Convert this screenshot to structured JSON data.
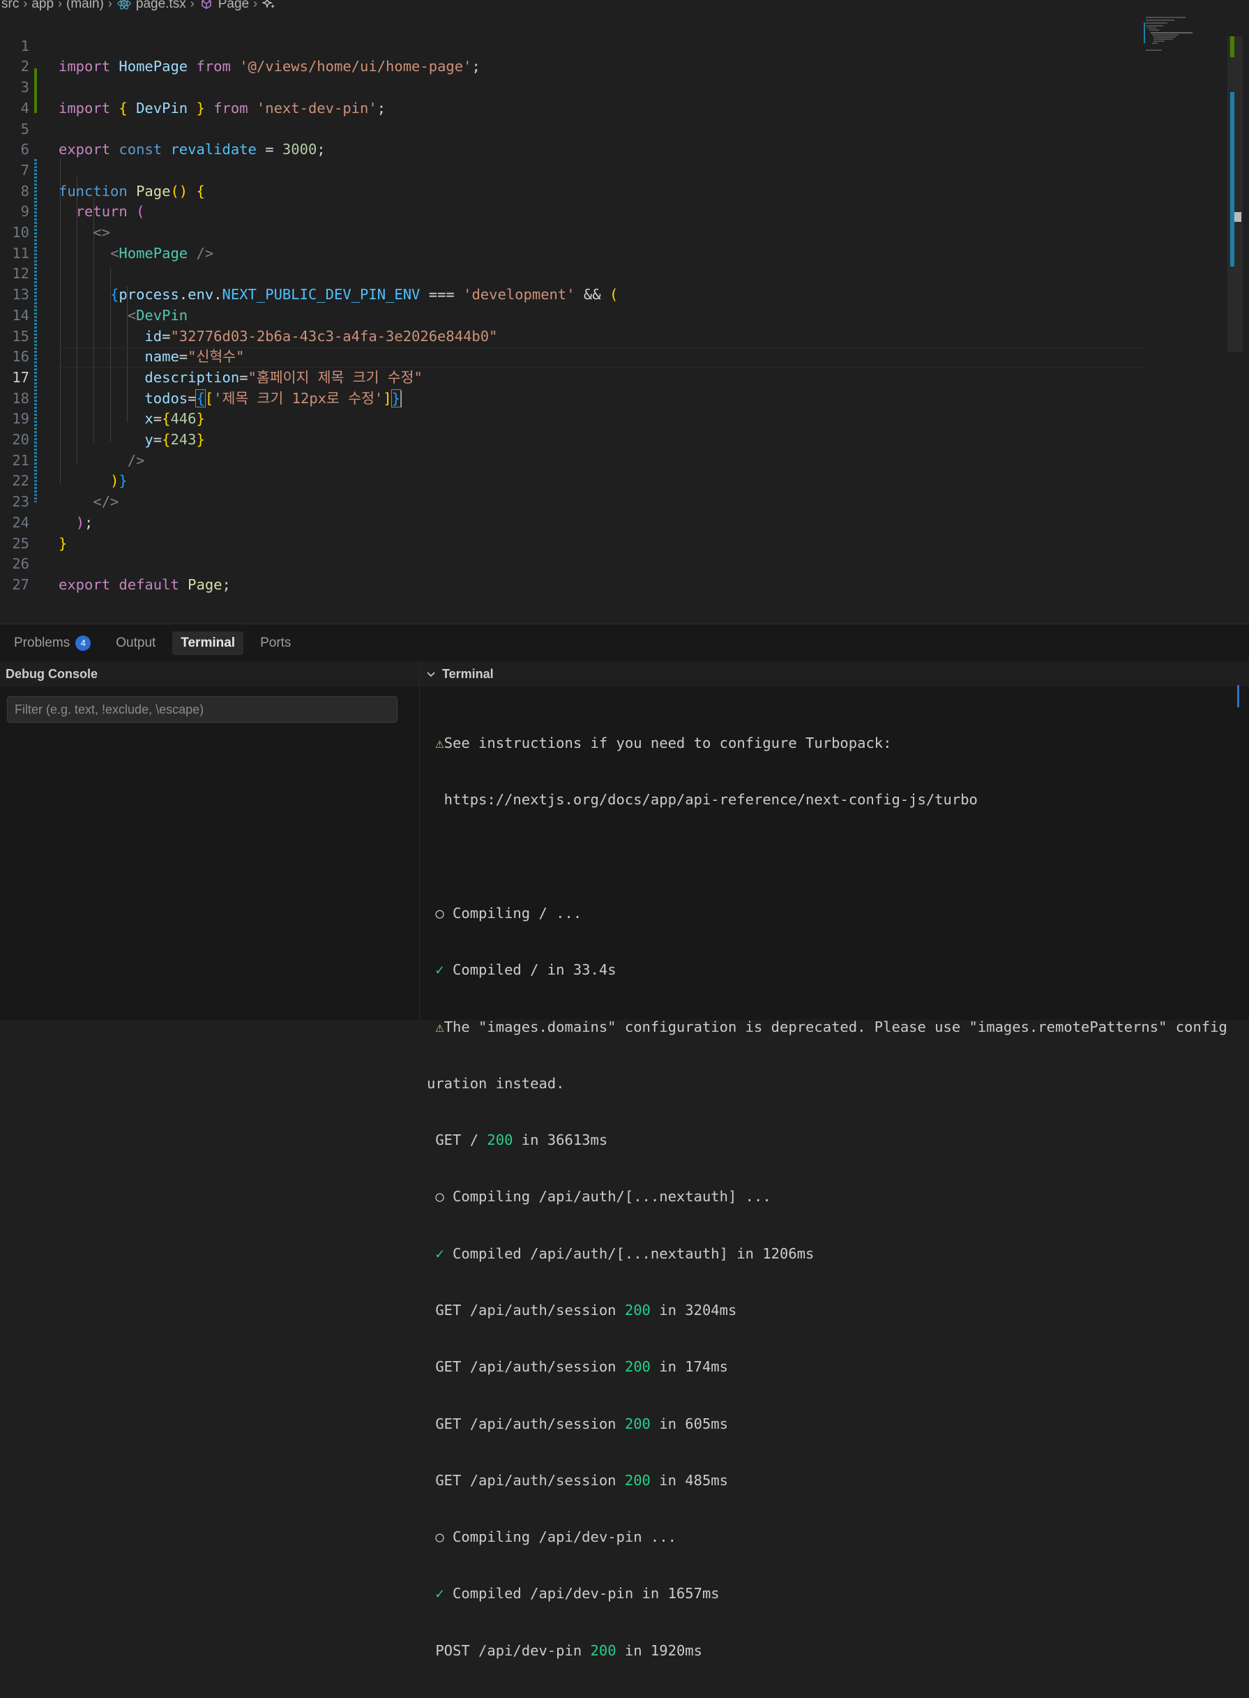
{
  "breadcrumb": {
    "items": [
      "src",
      "app",
      "(main)",
      "page.tsx",
      "Page"
    ],
    "icons": [
      "react-icon",
      "symbol-method-icon",
      "sparkle-icon"
    ]
  },
  "editor": {
    "active_line": "17",
    "lines": [
      {
        "n": "1"
      },
      {
        "n": "2"
      },
      {
        "n": "3"
      },
      {
        "n": "4"
      },
      {
        "n": "5"
      },
      {
        "n": "6"
      },
      {
        "n": "7"
      },
      {
        "n": "8"
      },
      {
        "n": "9"
      },
      {
        "n": "10"
      },
      {
        "n": "11"
      },
      {
        "n": "12"
      },
      {
        "n": "13"
      },
      {
        "n": "14"
      },
      {
        "n": "15"
      },
      {
        "n": "16"
      },
      {
        "n": "17"
      },
      {
        "n": "18"
      },
      {
        "n": "19"
      },
      {
        "n": "20"
      },
      {
        "n": "21"
      },
      {
        "n": "22"
      },
      {
        "n": "23"
      },
      {
        "n": "24"
      },
      {
        "n": "25"
      },
      {
        "n": "26"
      },
      {
        "n": "27"
      }
    ],
    "tokens": {
      "l1": [
        "import",
        " ",
        "HomePage",
        " ",
        "from",
        " ",
        "'@/views/home/ui/home-page'",
        ";"
      ],
      "l3": [
        "import",
        " ",
        "{",
        " ",
        "DevPin",
        " ",
        "}",
        " ",
        "from",
        " ",
        "'next-dev-pin'",
        ";"
      ],
      "l5": [
        "export",
        " ",
        "const",
        " ",
        "revalidate",
        " = ",
        "3000",
        ";"
      ],
      "l7": [
        "function",
        " ",
        "Page",
        "()",
        " ",
        "{"
      ],
      "l8": [
        "  ",
        "return",
        " ",
        "("
      ],
      "l9": [
        "    ",
        "<>"
      ],
      "l10": [
        "      ",
        "<",
        "HomePage",
        " />"
      ],
      "l12": [
        "      ",
        "{",
        "process",
        ".",
        "env",
        ".",
        "NEXT_PUBLIC_DEV_PIN_ENV",
        " === ",
        "'development'",
        " && ",
        "("
      ],
      "l13": [
        "        ",
        "<",
        "DevPin"
      ],
      "l14": [
        "          ",
        "id",
        "=",
        "\"32776d03-2b6a-43c3-a4fa-3e2026e844b0\""
      ],
      "l15": [
        "          ",
        "name",
        "=",
        "\"신혁수\""
      ],
      "l16": [
        "          ",
        "description",
        "=",
        "\"홈페이지 제목 크기 수정\""
      ],
      "l17": [
        "          ",
        "todos",
        "=",
        "{",
        "[",
        "'제목 크기 12px로 수정'",
        "]",
        "}"
      ],
      "l18": [
        "          ",
        "x",
        "=",
        "{",
        "446",
        "}"
      ],
      "l19": [
        "          ",
        "y",
        "=",
        "{",
        "243",
        "}"
      ],
      "l20": [
        "        ",
        "/>"
      ],
      "l21": [
        "      ",
        ")",
        "}"
      ],
      "l22": [
        "    ",
        "</>"
      ],
      "l23": [
        "  ",
        ")",
        ";"
      ],
      "l24": [
        "}"
      ],
      "l26": [
        "export",
        " ",
        "default",
        " ",
        "Page",
        ";"
      ]
    }
  },
  "panel": {
    "tabs": [
      {
        "label": "Problems",
        "badge": "4"
      },
      {
        "label": "Output"
      },
      {
        "label": "Terminal"
      },
      {
        "label": "Ports"
      }
    ],
    "debug_console": {
      "title": "Debug Console",
      "filter_placeholder": "Filter (e.g. text, !exclude, \\escape)"
    },
    "terminal": {
      "title": "Terminal",
      "lines": [
        {
          "prefix": "⚠",
          "text": "See instructions if you need to configure Turbopack:"
        },
        {
          "text": "  https://nextjs.org/docs/app/api-reference/next-config-js/turbo"
        },
        {
          "text": ""
        },
        {
          "prefix": "○",
          "text": "Compiling / ..."
        },
        {
          "prefix": "✓",
          "text": "Compiled / in 33.4s"
        },
        {
          "prefix": "⚠",
          "text": "The \"images.domains\" configuration is deprecated. Please use \"images.remotePatterns\" config"
        },
        {
          "text": "uration instead."
        },
        {
          "req": "GET /",
          "status": "200",
          "rest": "in 36613ms"
        },
        {
          "prefix": "○",
          "text": "Compiling /api/auth/[...nextauth] ..."
        },
        {
          "prefix": "✓",
          "text": "Compiled /api/auth/[...nextauth] in 1206ms"
        },
        {
          "req": "GET /api/auth/session",
          "status": "200",
          "rest": "in 3204ms"
        },
        {
          "req": "GET /api/auth/session",
          "status": "200",
          "rest": "in 174ms"
        },
        {
          "req": "GET /api/auth/session",
          "status": "200",
          "rest": "in 605ms"
        },
        {
          "req": "GET /api/auth/session",
          "status": "200",
          "rest": "in 485ms"
        },
        {
          "prefix": "○",
          "text": "Compiling /api/dev-pin ..."
        },
        {
          "prefix": "✓",
          "text": "Compiled /api/dev-pin in 1657ms"
        },
        {
          "req": "POST /api/dev-pin",
          "status": "200",
          "rest": "in 1920ms"
        }
      ]
    }
  },
  "colors": {
    "keyword": "#c586c0",
    "keyword_blue": "#569cd6",
    "function": "#dcdcaa",
    "type": "#4ec9b0",
    "variable": "#9cdcfe",
    "string": "#ce9178",
    "number": "#b5cea8",
    "accent": "#2f6ed3",
    "success": "#23d18b",
    "warning": "#e5c07b"
  }
}
